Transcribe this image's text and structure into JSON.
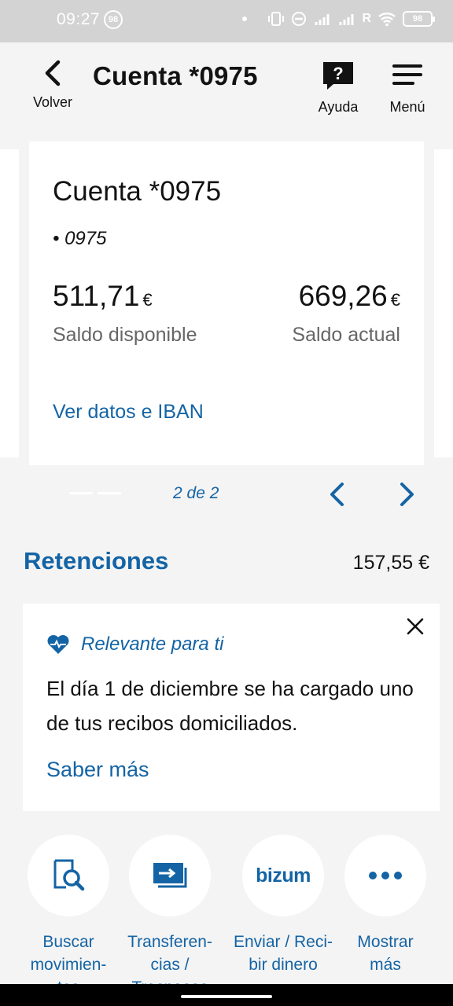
{
  "status_bar": {
    "time": "09:27",
    "notif_count": "98",
    "carrier_r": "R",
    "battery": "98"
  },
  "header": {
    "back_label": "Volver",
    "title": "Cuenta *0975",
    "help_label": "Ayuda",
    "menu_label": "Menú"
  },
  "account_card": {
    "title": "Cuenta *0975",
    "subtitle": "• 0975",
    "available_balance": "511,71",
    "available_currency": "€",
    "available_label": "Saldo disponible",
    "current_balance": "669,26",
    "current_currency": "€",
    "current_label": "Saldo actual",
    "link": "Ver datos e IBAN"
  },
  "pager": {
    "text": "2 de 2"
  },
  "retenciones": {
    "title": "Retenciones",
    "amount": "157,55 €"
  },
  "notice": {
    "tag": "Relevante para ti",
    "text": "El día 1 de diciembre se ha cargado uno de tus recibos domiciliados.",
    "link": "Saber más"
  },
  "actions": [
    {
      "label": "Buscar\nmovimien-\ntos",
      "icon": "search-document-icon"
    },
    {
      "label": "Transferen-\ncias /\nTraspasos",
      "icon": "transfer-icon"
    },
    {
      "label": "Enviar / Reci-\nbir dinero",
      "icon": "bizum-logo",
      "logo_text": "bizum"
    },
    {
      "label": "Mostrar\nmás",
      "icon": "more-dots-icon"
    }
  ],
  "colors": {
    "accent": "#1464a5",
    "background": "#f4f4f4",
    "card": "#ffffff"
  }
}
